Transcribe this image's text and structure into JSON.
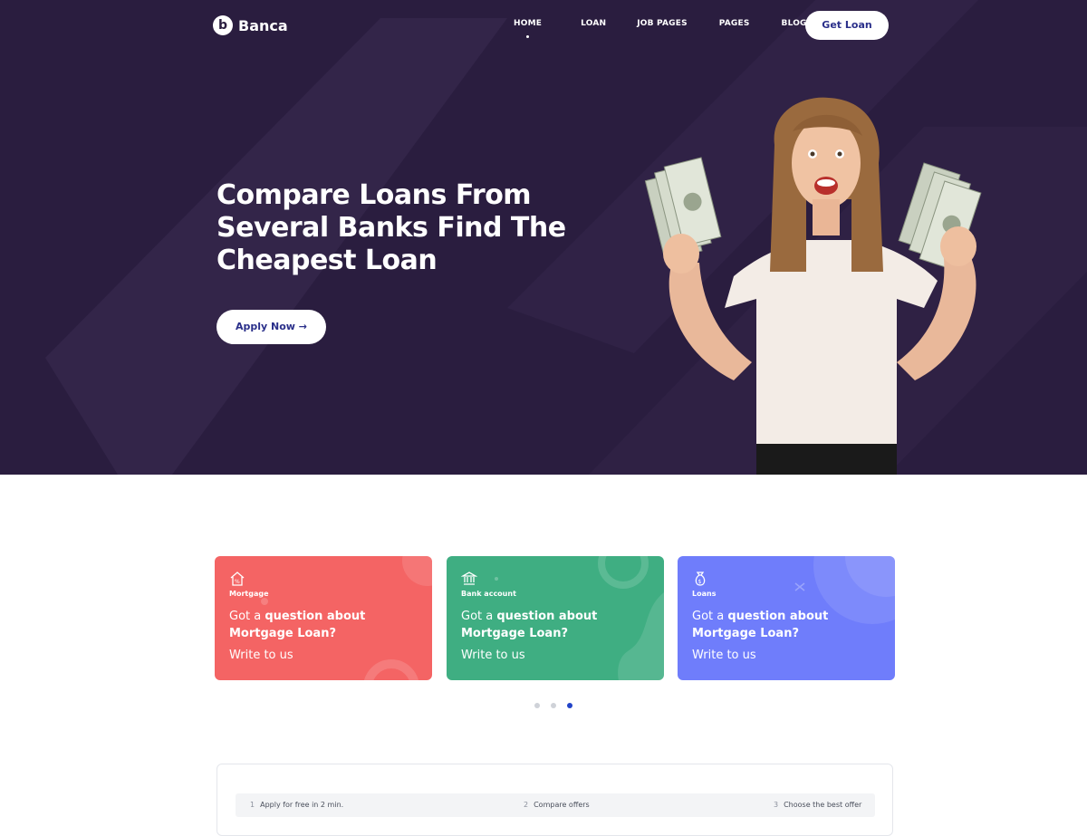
{
  "brand": {
    "logo_letter": "b",
    "name": "Banca"
  },
  "nav": {
    "items": [
      "HOME",
      "LOAN",
      "JOB PAGES",
      "PAGES",
      "BLOG"
    ],
    "active_index": 0,
    "cta_label": "Get Loan"
  },
  "hero": {
    "title": "Compare Loans From Several Banks Find The Cheapest Loan",
    "button_label": "Apply Now →"
  },
  "cards": [
    {
      "icon": "house-percent-icon",
      "label": "Mortgage",
      "question_prefix": "Got a",
      "question_bold": "question about Mortgage Loan?",
      "link": "Write to us",
      "color": "#f46464"
    },
    {
      "icon": "bank-icon",
      "label": "Bank account",
      "question_prefix": "Got a",
      "question_bold": "question about Mortgage Loan?",
      "link": "Write to us",
      "color": "#3fae82"
    },
    {
      "icon": "money-bag-icon",
      "label": "Loans",
      "question_prefix": "Got a",
      "question_bold": "question about Mortgage Loan?",
      "link": "Write to us",
      "color": "#6f7dfb"
    }
  ],
  "carousel": {
    "dot_count": 3,
    "active_index": 2
  },
  "steps": [
    {
      "n": "1",
      "label": "Apply for free in 2 min."
    },
    {
      "n": "2",
      "label": "Compare offers"
    },
    {
      "n": "3",
      "label": "Choose the best offer"
    }
  ],
  "colors": {
    "hero_bg": "#2a1d3f",
    "accent": "#2344c8",
    "button_text": "#2a2f8a"
  }
}
